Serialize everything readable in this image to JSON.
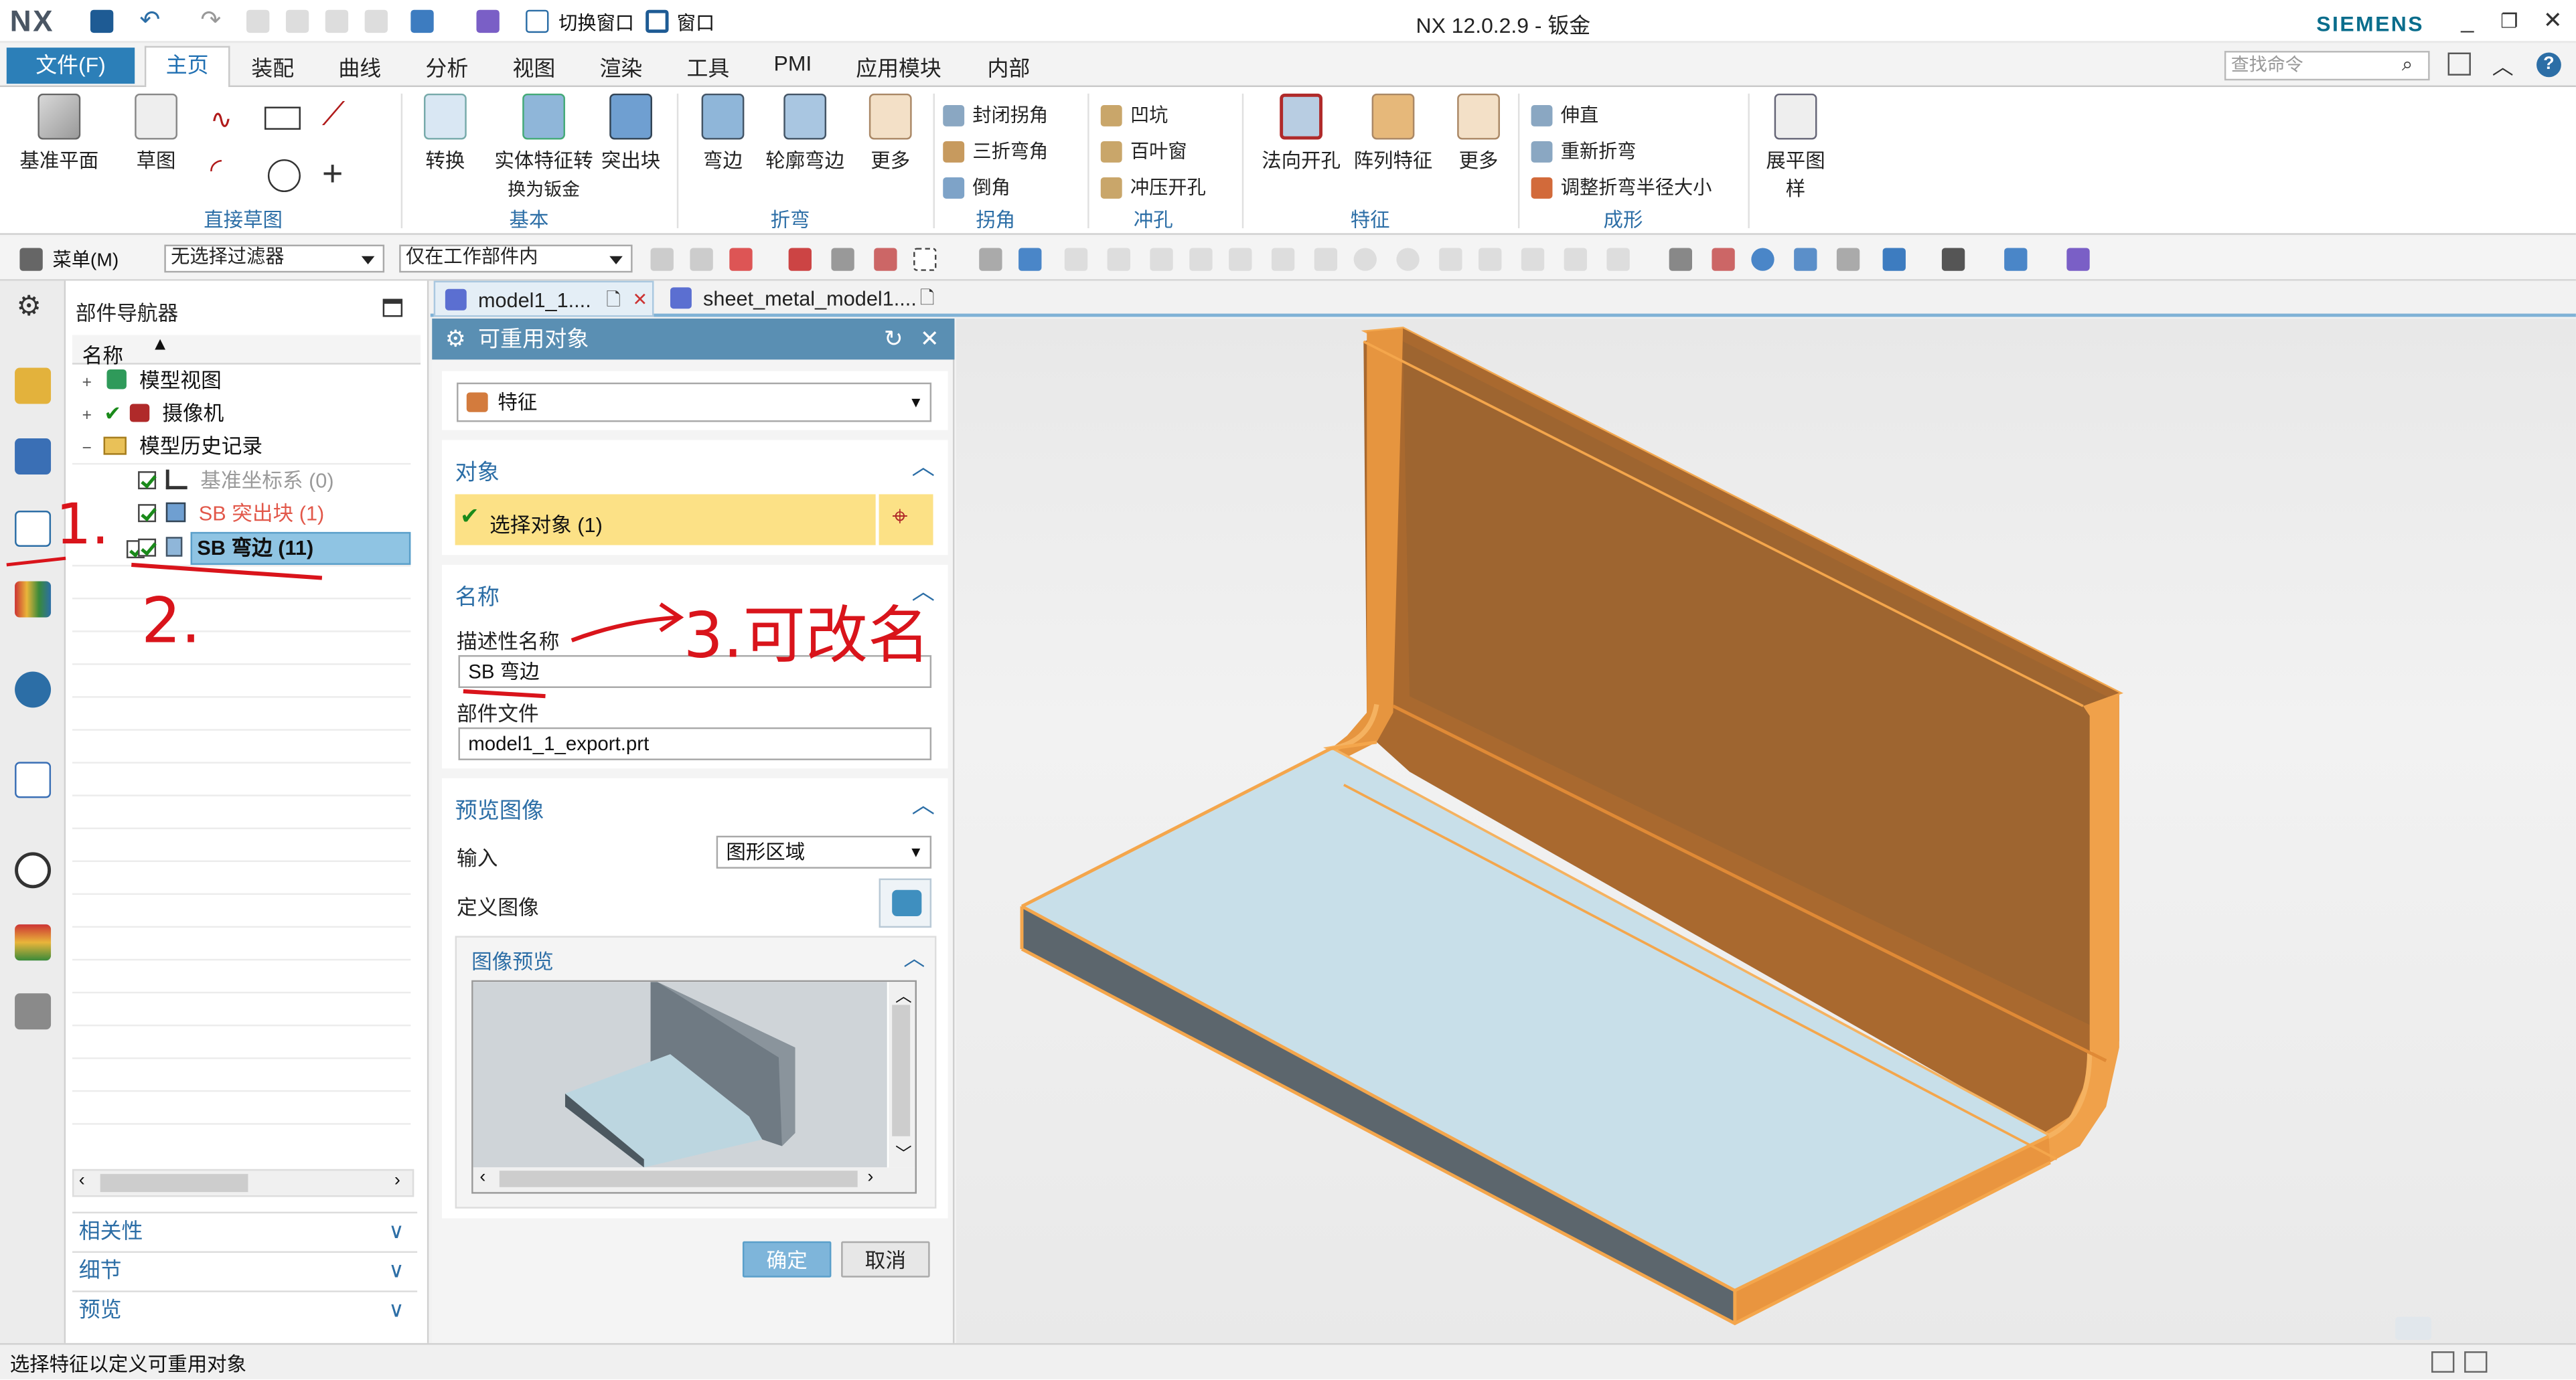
{
  "app": {
    "logo": "NX",
    "window_title": "NX 12.0.2.9 - 钣金",
    "brand": "SIEMENS",
    "quick_access": {
      "switch_window": "切换窗口",
      "window": "窗口"
    }
  },
  "menu_tabs": {
    "file": "文件(F)",
    "tabs": [
      "主页",
      "装配",
      "曲线",
      "分析",
      "视图",
      "渲染",
      "工具",
      "PMI",
      "应用模块",
      "内部"
    ],
    "search_placeholder": "查找命令"
  },
  "ribbon": {
    "datum_plane": "基准平面",
    "sketch": "草图",
    "direct_sketch_group": "直接草图",
    "convert": "转换",
    "solid_to_sheet": "实体特征转",
    "solid_to_sheet2": "换为钣金",
    "tab": "突出块",
    "base_group": "基本",
    "flange": "弯边",
    "contour_flange": "轮廓弯边",
    "more1": "更多",
    "bend_group": "折弯",
    "closed_corner": "封闭拐角",
    "three_bend_corner": "三折弯角",
    "chamfer": "倒角",
    "corner_group": "拐角",
    "dimple": "凹坑",
    "louver": "百叶窗",
    "drawn_cutout": "冲压开孔",
    "punch_group": "冲孔",
    "normal_cutout": "法向开孔",
    "pattern_feature": "阵列特征",
    "more2": "更多",
    "feature_group": "特征",
    "unbend": "伸直",
    "rebend": "重新折弯",
    "resize_bend_radius": "调整折弯半径大小",
    "form_group": "成形",
    "flat_pattern": "展平图样"
  },
  "toolbar2": {
    "menu": "菜单(M)",
    "filter": "无选择过滤器",
    "scope": "仅在工作部件内"
  },
  "navigator": {
    "title": "部件导航器",
    "column_name": "名称",
    "nodes": [
      {
        "label": "模型视图"
      },
      {
        "label": "摄像机"
      },
      {
        "label": "模型历史记录"
      },
      {
        "label": "基准坐标系 (0)"
      },
      {
        "label": "SB 突出块 (1)"
      },
      {
        "label": "SB 弯边 (11)"
      }
    ],
    "sections": [
      "相关性",
      "细节",
      "预览"
    ]
  },
  "doc_tabs": [
    "model1_1....",
    "sheet_metal_model1...."
  ],
  "dialog": {
    "title": "可重用对象",
    "type_value": "特征",
    "object_section": "对象",
    "select_object": "选择对象 (1)",
    "name_section": "名称",
    "desc_name_label": "描述性名称",
    "desc_name_value": "SB 弯边",
    "part_file_label": "部件文件",
    "part_file_value": "model1_1_export.prt",
    "preview_section": "预览图像",
    "input_label": "输入",
    "input_value": "图形区域",
    "define_image_label": "定义图像",
    "image_preview_section": "图像预览",
    "ok": "确定",
    "cancel": "取消"
  },
  "annotations": {
    "a1": "1.",
    "a2": "2.",
    "a3": "3.可改名"
  },
  "status": {
    "message": "选择特征以定义可重用对象"
  },
  "colors": {
    "accent": "#2c7fb8",
    "dialog_header": "#5a8fb3",
    "highlight_row": "#8fc4e3",
    "select_yellow": "#fce186",
    "part_orange": "#c9833f",
    "part_light": "#c8dfe9",
    "annotation_red": "#d9141b"
  }
}
